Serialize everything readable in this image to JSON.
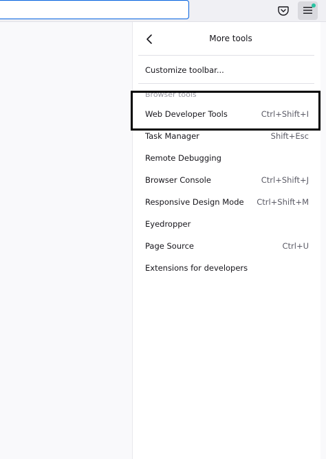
{
  "toolbar": {
    "url_value": "",
    "pocket_icon": "pocket-icon",
    "menu_icon": "hamburger-menu-icon",
    "accent_color": "#0060df",
    "update_dot_color": "#2ac3a2"
  },
  "panel": {
    "title": "More tools",
    "customize_label": "Customize toolbar...",
    "section_label": "Browser tools",
    "items": [
      {
        "label": "Web Developer Tools",
        "shortcut": "Ctrl+Shift+I"
      },
      {
        "label": "Task Manager",
        "shortcut": "Shift+Esc"
      },
      {
        "label": "Remote Debugging",
        "shortcut": ""
      },
      {
        "label": "Browser Console",
        "shortcut": "Ctrl+Shift+J"
      },
      {
        "label": "Responsive Design Mode",
        "shortcut": "Ctrl+Shift+M"
      },
      {
        "label": "Eyedropper",
        "shortcut": ""
      },
      {
        "label": "Page Source",
        "shortcut": "Ctrl+U"
      },
      {
        "label": "Extensions for developers",
        "shortcut": ""
      }
    ]
  }
}
